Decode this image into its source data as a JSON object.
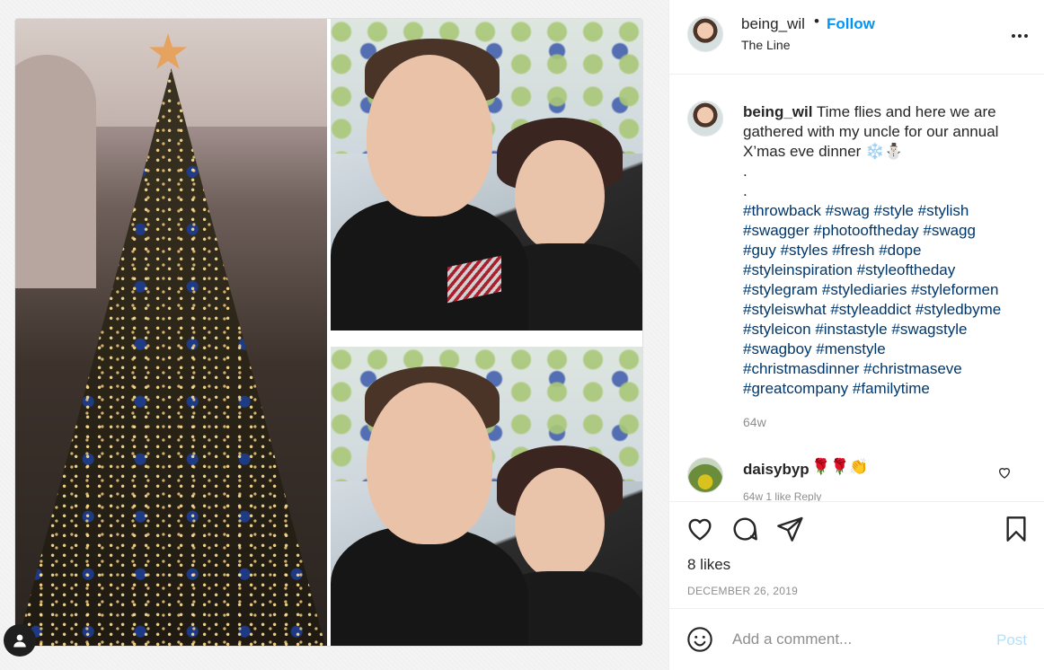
{
  "post": {
    "username": "being_wil",
    "follow_label": "Follow",
    "separator": "•",
    "location": "The Line"
  },
  "caption": {
    "username": "being_wil",
    "text_lines": [
      "Time flies and here we are",
      "gathered with my uncle for our annual",
      "X’mas eve dinner ❄️⛄"
    ],
    "dots": [
      ".",
      "."
    ],
    "hashtag_lines": [
      "#throwback #swag #style #stylish",
      "#swagger #photooftheday #swagg",
      "#guy #styles #fresh #dope",
      "#styleinspiration #styleoftheday",
      "#stylegram #stylediaries #styleformen",
      "#styleiswhat #styleaddict #styledbyme",
      "#styleicon #instastyle #swagstyle",
      "#swagboy #menstyle",
      "#christmasdinner #christmaseve",
      "#greatcompany #familytime"
    ],
    "time": "64w"
  },
  "comment": {
    "username": "daisybyp",
    "text": "🌹🌹👏",
    "meta": "64w  1 like  Reply"
  },
  "actions": {
    "likes": "8 likes",
    "date": "DECEMBER 26, 2019"
  },
  "composer": {
    "placeholder": "Add a comment...",
    "post_label": "Post"
  },
  "icons": {
    "more": "more-horizontal-icon",
    "like": "heart-icon",
    "comment": "comment-bubble-icon",
    "share": "paper-plane-icon",
    "save": "bookmark-icon",
    "emoji": "smiley-icon",
    "user_tag": "user-tag-icon"
  },
  "colors": {
    "accent": "#0095f6",
    "hashtag": "#00376b",
    "muted": "#8e8e8e",
    "post_disabled": "#b2dffc"
  }
}
